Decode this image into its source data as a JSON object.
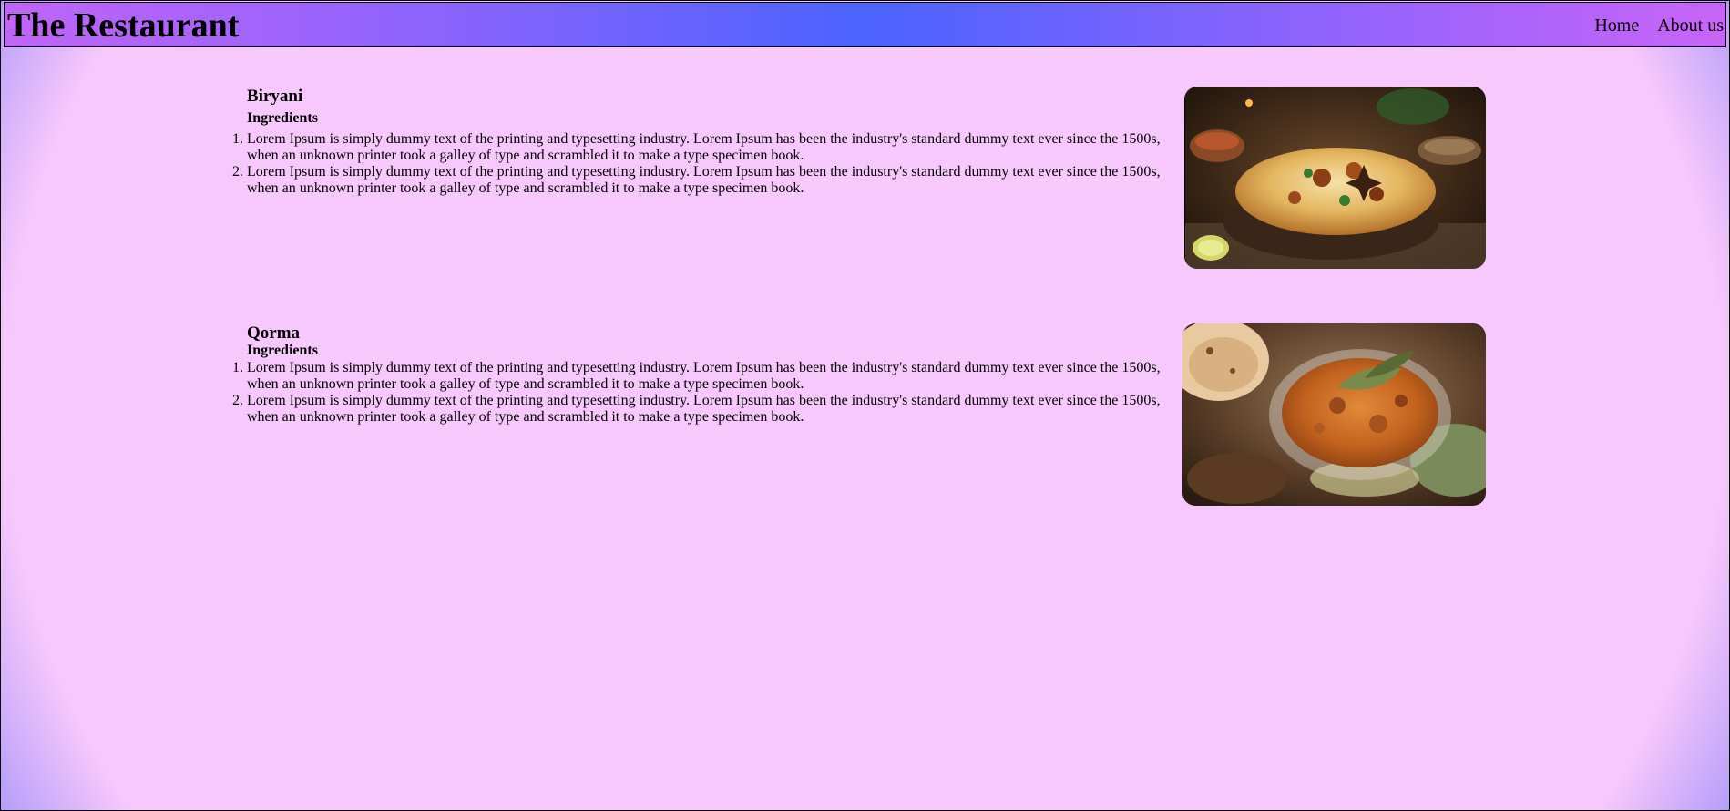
{
  "header": {
    "title": "The Restaurant",
    "nav": [
      "Home",
      "About us"
    ]
  },
  "dishes": [
    {
      "name": "Biryani",
      "ingredients_label": "Ingredients",
      "ingredients": [
        "Lorem Ipsum is simply dummy text of the printing and typesetting industry. Lorem Ipsum has been the industry's standard dummy text ever since the 1500s, when an unknown printer took a galley of type and scrambled it to make a type specimen book.",
        "Lorem Ipsum is simply dummy text of the printing and typesetting industry. Lorem Ipsum has been the industry's standard dummy text ever since the 1500s, when an unknown printer took a galley of type and scrambled it to make a type specimen book."
      ]
    },
    {
      "name": "Qorma",
      "ingredients_label": "Ingredients",
      "ingredients": [
        "Lorem Ipsum is simply dummy text of the printing and typesetting industry. Lorem Ipsum has been the industry's standard dummy text ever since the 1500s, when an unknown printer took a galley of type and scrambled it to make a type specimen book.",
        "Lorem Ipsum is simply dummy text of the printing and typesetting industry. Lorem Ipsum has been the industry's standard dummy text ever since the 1500s, when an unknown printer took a galley of type and scrambled it to make a type specimen book."
      ]
    }
  ],
  "colors": {
    "background": "#f7c8fb",
    "header_accent": "#4b63ff",
    "header_edge": "#c165f8"
  }
}
